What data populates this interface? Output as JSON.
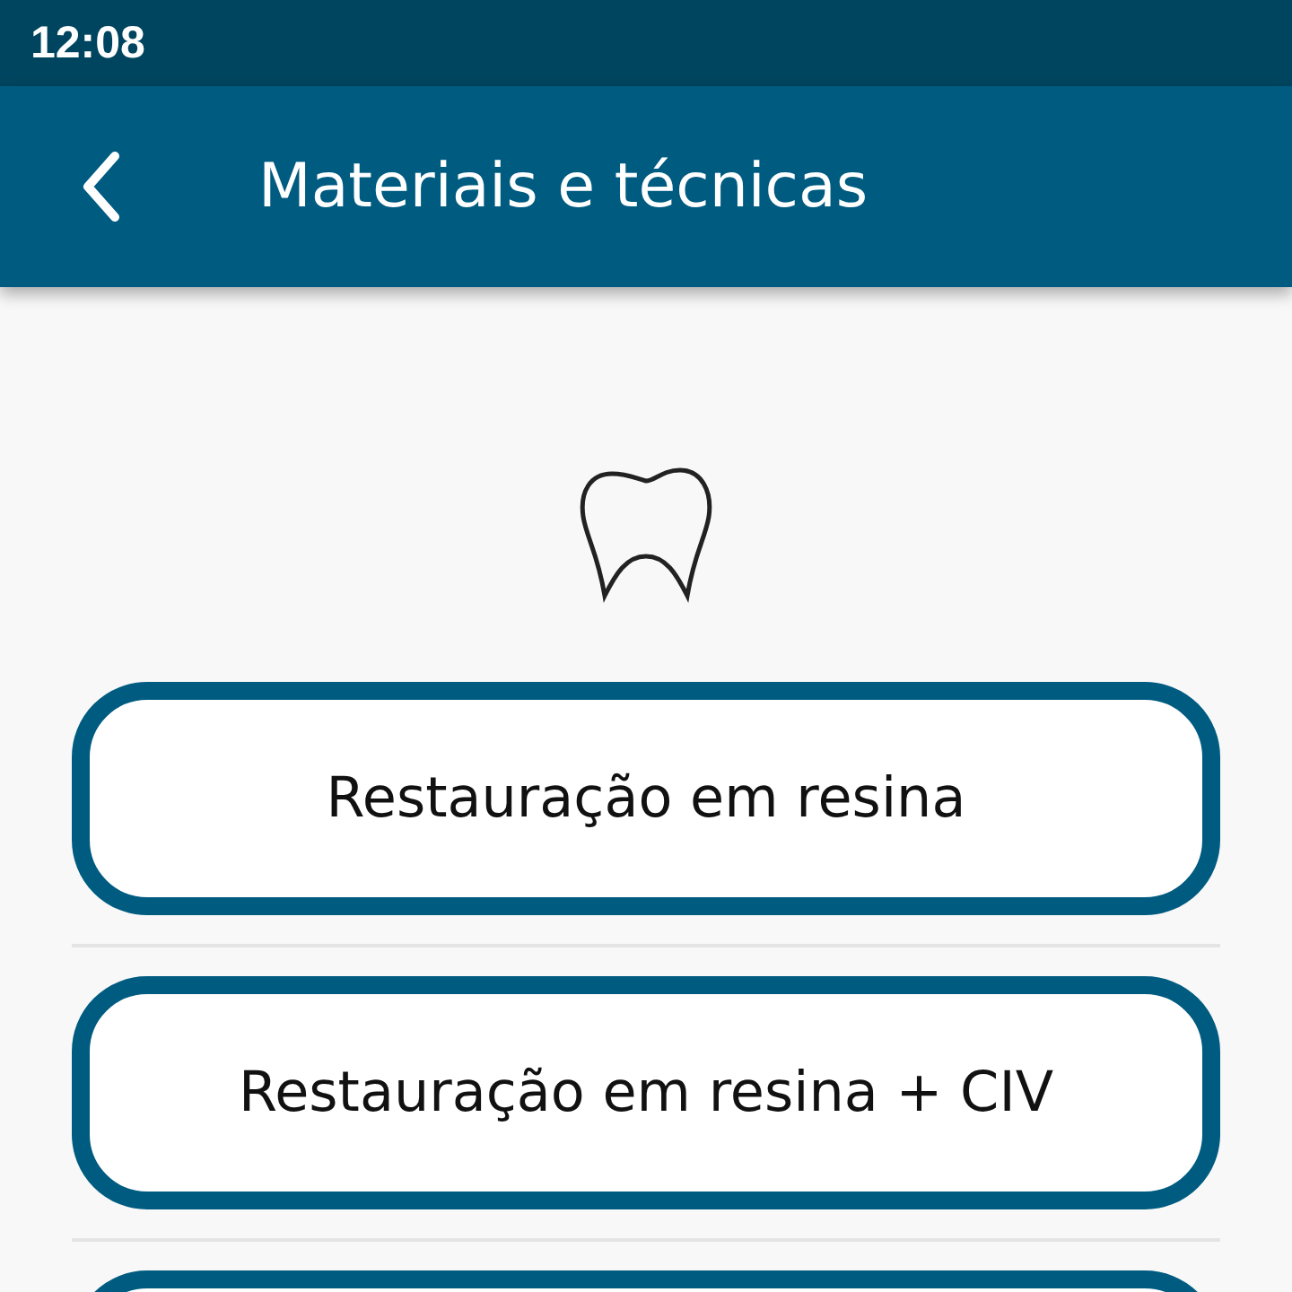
{
  "status_bar": {
    "time": "12:08"
  },
  "app_bar": {
    "title": "Materiais e técnicas"
  },
  "options": [
    {
      "kind": "option",
      "label": "Restauração em resina"
    },
    {
      "kind": "option",
      "label": "Restauração em resina + CIV"
    },
    {
      "kind": "cut"
    }
  ]
}
